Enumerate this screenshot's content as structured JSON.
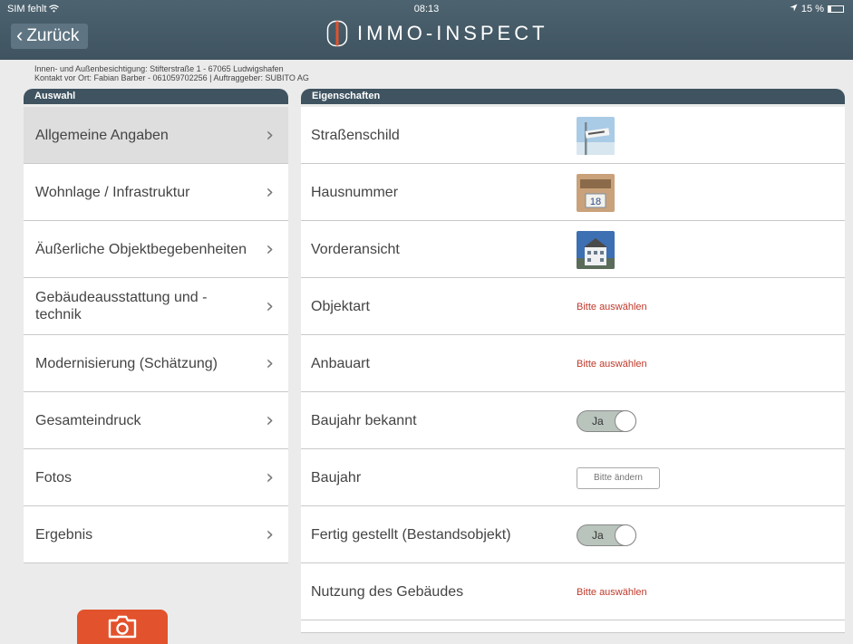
{
  "status_bar": {
    "carrier": "SIM fehlt",
    "time": "08:13",
    "battery": "15 %"
  },
  "nav": {
    "back_label": "Zurück",
    "logo_text": "IMMO-INSPECT"
  },
  "info": {
    "line1": "Innen- und Außenbesichtigung: Stifterstraße 1 - 67065 Ludwigshafen",
    "line2": "Kontakt vor Ort: Fabian Barber - 061059702256 | Auftraggeber: SUBITO AG"
  },
  "left_panel": {
    "header": "Auswahl",
    "items": [
      {
        "label": "Allgemeine Angaben"
      },
      {
        "label": "Wohnlage / Infrastruktur"
      },
      {
        "label": "Äußerliche Objektbegebenheiten"
      },
      {
        "label": "Gebäudeausstattung und - technik"
      },
      {
        "label": "Modernisierung (Schätzung)"
      },
      {
        "label": "Gesamteindruck"
      },
      {
        "label": "Fotos"
      },
      {
        "label": "Ergebnis"
      }
    ]
  },
  "right_panel": {
    "header": "Eigenschaften",
    "rows": [
      {
        "label": "Straßenschild",
        "value_type": "image",
        "icon": "street-sign-photo"
      },
      {
        "label": "Hausnummer",
        "value_type": "image",
        "icon": "house-number-photo",
        "image_text": "18"
      },
      {
        "label": "Vorderansicht",
        "value_type": "image",
        "icon": "front-view-photo"
      },
      {
        "label": "Objektart",
        "value_type": "link",
        "value": "Bitte auswählen"
      },
      {
        "label": "Anbauart",
        "value_type": "link",
        "value": "Bitte auswählen"
      },
      {
        "label": "Baujahr bekannt",
        "value_type": "toggle",
        "value": "Ja"
      },
      {
        "label": "Baujahr",
        "value_type": "input",
        "placeholder": "Bitte ändern"
      },
      {
        "label": "Fertig gestellt (Bestandsobjekt)",
        "value_type": "toggle",
        "value": "Ja"
      },
      {
        "label": "Nutzung des Gebäudes",
        "value_type": "link",
        "value": "Bitte auswählen"
      }
    ]
  },
  "colors": {
    "topbar": "#3f5360",
    "accent_red": "#c0392b",
    "camera": "#e2522c"
  }
}
